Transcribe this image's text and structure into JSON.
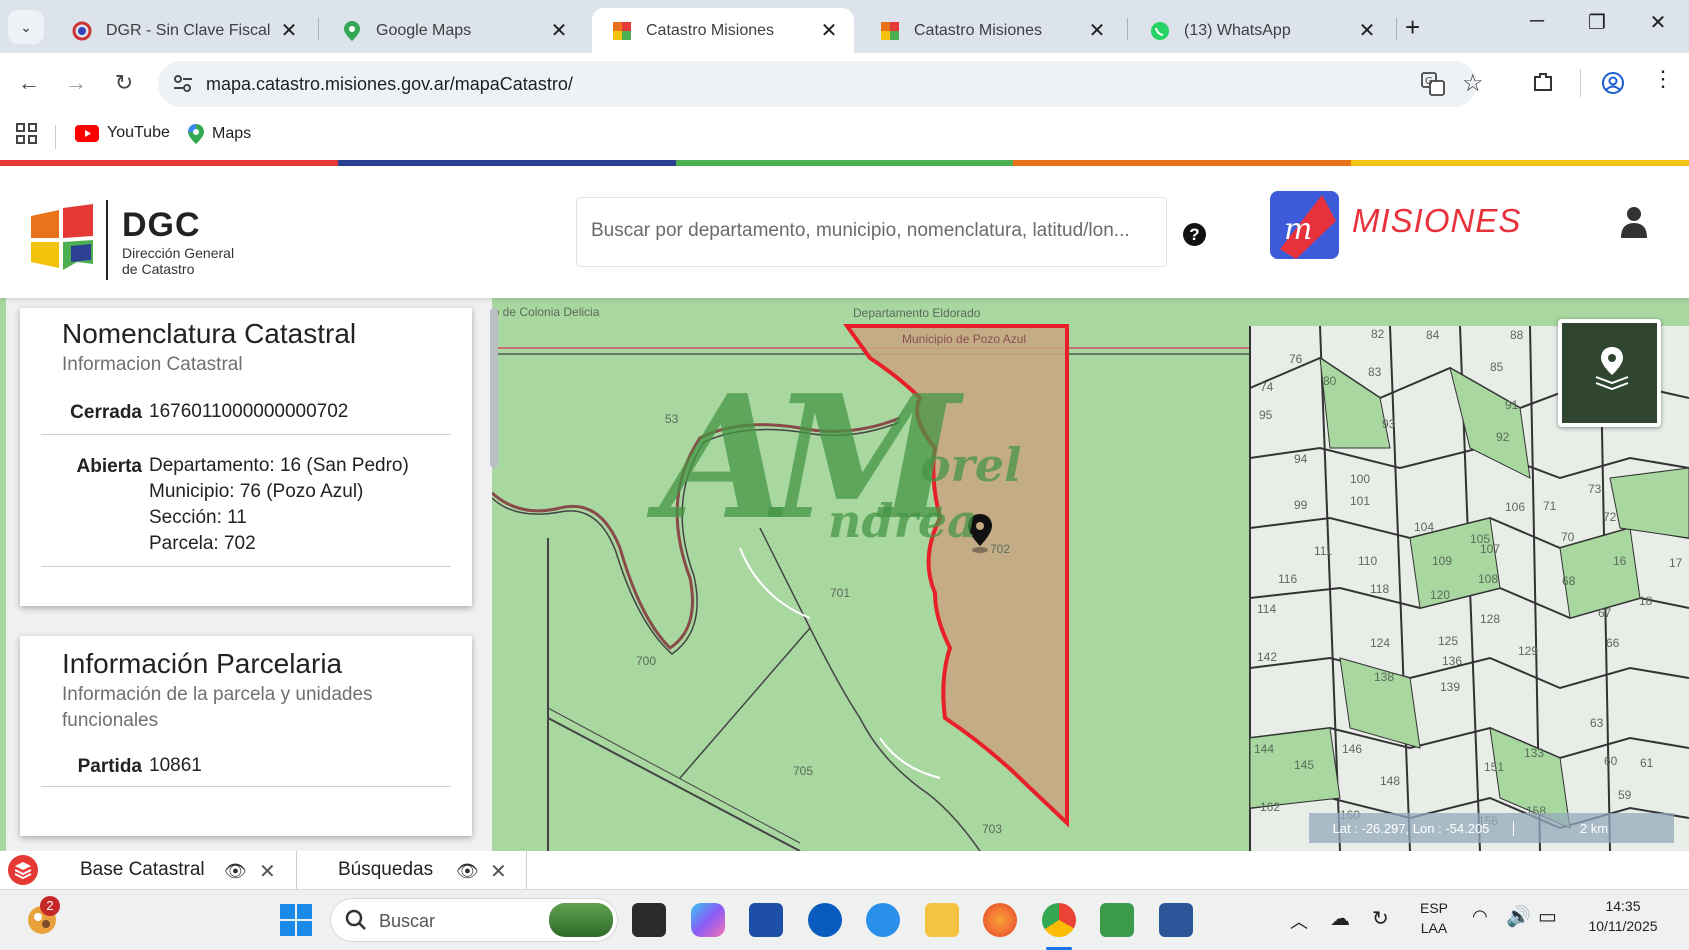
{
  "browser": {
    "tabs": [
      {
        "title": "DGR - Sin Clave Fiscal",
        "active": false
      },
      {
        "title": "Google Maps",
        "active": false
      },
      {
        "title": "Catastro Misiones",
        "active": true
      },
      {
        "title": "Catastro Misiones",
        "active": false
      },
      {
        "title": "(13) WhatsApp",
        "active": false
      }
    ],
    "url": "mapa.catastro.misiones.gov.ar/mapaCatastro/",
    "bookmarks": [
      "YouTube",
      "Maps"
    ]
  },
  "header": {
    "logo_title": "DGC",
    "logo_subtitle_1": "Dirección General",
    "logo_subtitle_2": "de Catastro",
    "search_placeholder": "Buscar por departamento, municipio, nomenclatura, latitud/lon...",
    "help_label": "?",
    "brand_text": "MISIONES",
    "colors": {
      "bar": [
        "#e53935",
        "#2b3f93",
        "#4caf50",
        "#e8731a",
        "#f4c20d"
      ],
      "brand_box": "#3d5bd9",
      "brand_text": "#e8323b"
    }
  },
  "nomenclatura": {
    "title": "Nomenclatura Catastral",
    "subtitle": "Informacion Catastral",
    "cerrada_label": "Cerrada",
    "cerrada_value": "1676011000000000702",
    "abierta_label": "Abierta",
    "abierta_lines": [
      "Departamento: 16 (San Pedro)",
      "Municipio: 76 (Pozo Azul)",
      "Sección: 11",
      "Parcela: 702"
    ]
  },
  "parcelaria": {
    "title": "Información Parcelaria",
    "subtitle": "Información de la parcela y unidades funcionales",
    "partida_label": "Partida",
    "partida_value": "10861"
  },
  "map": {
    "labels": {
      "colonia": "io de Colonia Delicia",
      "departamento": "Departamento Eldorado",
      "municipio": "Municipio de Pozo Azul"
    },
    "parcel_numbers": [
      "53",
      "701",
      "700",
      "705",
      "703",
      "702",
      "76",
      "80",
      "82",
      "83",
      "84",
      "85",
      "88",
      "74",
      "95",
      "93",
      "91",
      "92",
      "94",
      "100",
      "101",
      "99",
      "104",
      "105",
      "106",
      "111",
      "110",
      "116",
      "118",
      "109",
      "107",
      "108",
      "114",
      "124",
      "120",
      "125",
      "128",
      "142",
      "136",
      "138",
      "139",
      "129",
      "144",
      "145",
      "146",
      "148",
      "151",
      "133",
      "162",
      "160",
      "156",
      "158",
      "73",
      "72",
      "71",
      "70",
      "68",
      "67",
      "66",
      "63",
      "60",
      "61",
      "59",
      "16",
      "17",
      "18"
    ],
    "watermark_main": "AM",
    "watermark_script_1": "orel",
    "watermark_script_2": "ndrea",
    "coord_text": "Lat : -26.297, Lon : -54.205",
    "scale_text": "2 km",
    "colors": {
      "base": "#a8d7a0",
      "selected_fill": "#c6a783",
      "selected_border": "#e8202a"
    }
  },
  "layerbar": {
    "tabs": [
      "Base Catastral",
      "Búsquedas"
    ]
  },
  "taskbar": {
    "search_label": "Buscar",
    "notification_count": "2",
    "lang_1": "ESP",
    "lang_2": "LAA",
    "time": "14:35",
    "date": "10/11/2025"
  }
}
